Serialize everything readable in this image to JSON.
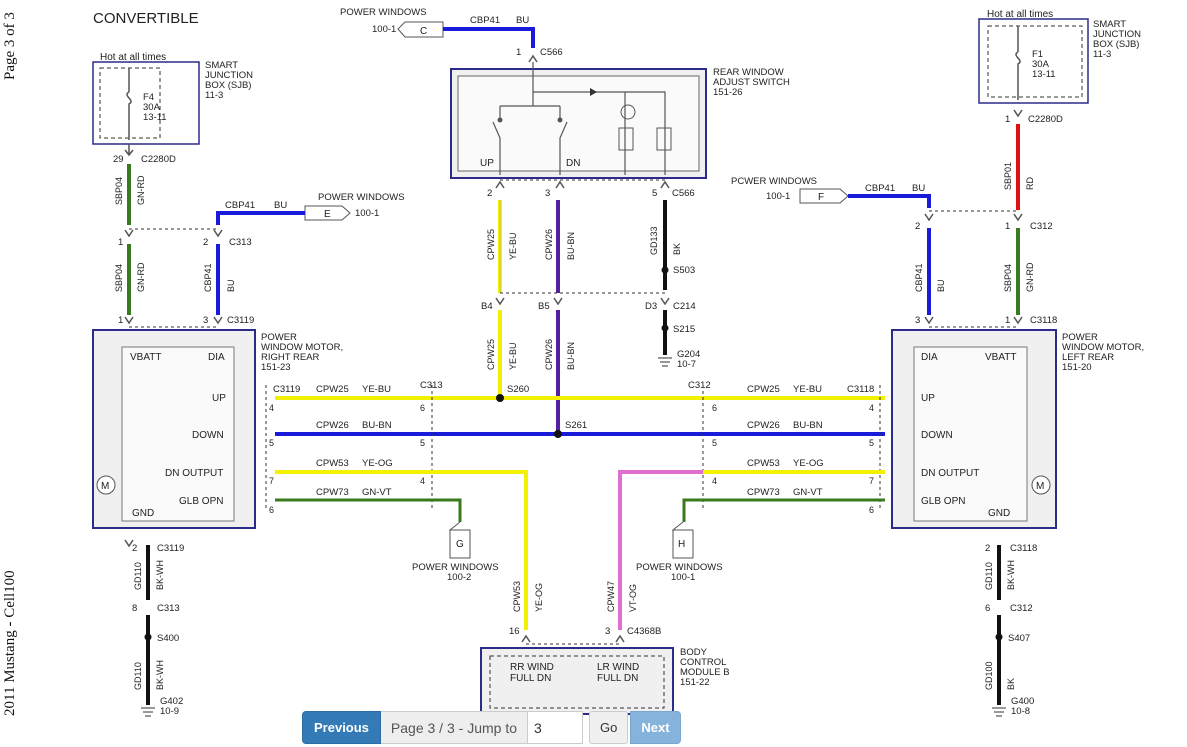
{
  "page": {
    "title": "CONVERTIBLE",
    "side_page": "Page 3 of 3",
    "side_model": "2011 Mustang - Cell100"
  },
  "colors": {
    "BU": "#1a1adb",
    "YE": "#f2f200",
    "VT": "#5520a0",
    "GN": "#3a7a1e",
    "RD": "#e01010",
    "BK": "#111111",
    "PK": "#e070d0",
    "WIRE": "#555555"
  },
  "labels": {
    "sjb_left": {
      "hot": "Hot at all times",
      "fuse": "F4",
      "amps": "30A",
      "ref": "13-11",
      "title1": "SMART",
      "title2": "JUNCTION",
      "title3": "BOX (SJB)",
      "page": "11-3"
    },
    "sjb_right": {
      "hot": "Hot at all times",
      "fuse": "F1",
      "amps": "30A",
      "ref": "13-11",
      "title1": "SMART",
      "title2": "JUNCTION",
      "title3": "BOX (SJB)",
      "page": "11-3"
    },
    "switch": {
      "title1": "REAR WINDOW",
      "title2": "ADJUST SWITCH",
      "page": "151-26",
      "up": "UP",
      "dn": "DN",
      "conn_top": "C566",
      "pin_top": "1",
      "conn_bot": "C566",
      "pins": [
        "2",
        "3",
        "5"
      ]
    },
    "pw_c": {
      "title": "POWER WINDOWS",
      "page": "100-1",
      "letter": "C",
      "circuit": "CBP41",
      "color": "BU"
    },
    "pw_e": {
      "title": "POWER WINDOWS",
      "page": "100-1",
      "letter": "E",
      "circuit": "CBP41",
      "color": "BU"
    },
    "pw_f": {
      "title": "PCWER WINDOWS",
      "page": "100-1",
      "letter": "F",
      "circuit": "CBP41",
      "color": "BU"
    },
    "pw_g": {
      "title": "POWER WINDOWS",
      "page": "100-2",
      "letter": "G"
    },
    "pw_h": {
      "title": "POWER WINDOWS",
      "page": "100-1",
      "letter": "H"
    },
    "motor_right": {
      "title1": "POWER",
      "title2": "WINDOW MOTOR,",
      "title3": "RIGHT REAR",
      "page": "151-23",
      "vbatt": "VBATT",
      "dia": "DIA",
      "up": "UP",
      "down": "DOWN",
      "dnout": "DN OUTPUT",
      "glb": "GLB OPN",
      "gnd": "GND",
      "m": "M"
    },
    "motor_left": {
      "title1": "POWER",
      "title2": "WINDOW MOTOR,",
      "title3": "LEFT REAR",
      "page": "151-20",
      "vbatt": "VBATT",
      "dia": "DIA",
      "up": "UP",
      "down": "DOWN",
      "dnout": "DN OUTPUT",
      "glb": "GLB OPN",
      "gnd": "GND",
      "m": "M"
    },
    "bcm": {
      "title1": "BODY",
      "title2": "CONTROL",
      "title3": "MODULE B",
      "page": "151-22",
      "rr1": "RR WIND",
      "rr2": "FULL DN",
      "lr1": "LR WIND",
      "lr2": "FULL DN",
      "conn": "C4368B",
      "pin16": "16",
      "pin3": "3"
    },
    "conn": {
      "c2280d_l": "C2280D",
      "pin29": "29",
      "c313": "C313",
      "pin1": "1",
      "pin2": "2",
      "c3119": "C3119",
      "pin3": "3",
      "c2280d_r": "C2280D",
      "c312": "C312",
      "c3118": "C3118",
      "c214": "C214",
      "b4": "B4",
      "b5": "B5",
      "d3": "D3",
      "s503": "S503",
      "s215": "S215",
      "g204": "G204",
      "g204p": "10-7",
      "s260": "S260",
      "s261": "S261",
      "s400": "S400",
      "g402": "G402",
      "g402p": "10-9",
      "s407": "S407",
      "g400": "G400",
      "g400p": "10-8",
      "p4": "4",
      "p5": "5",
      "p6": "6",
      "p7": "7",
      "p8": "8"
    },
    "wires": {
      "sbp04": "SBP04",
      "gnrd": "GN-RD",
      "cbp41": "CBP41",
      "bu": "BU",
      "sbp01": "SBP01",
      "rd": "RD",
      "cpw25": "CPW25",
      "yebu": "YE-BU",
      "cpw26": "CPW26",
      "bubn": "BU-BN",
      "gd133": "GD133",
      "bk": "BK",
      "cpw53": "CPW53",
      "yeog": "YE-OG",
      "cpw73": "CPW73",
      "gnvt": "GN-VT",
      "cpw47": "CPW47",
      "vtog": "VT-OG",
      "gd110": "GD110",
      "bkwh": "BK-WH",
      "gd100": "GD100"
    }
  },
  "pager": {
    "prev": "Previous",
    "text": "Page 3 / 3 - Jump to",
    "value": "3",
    "go": "Go",
    "next": "Next"
  }
}
